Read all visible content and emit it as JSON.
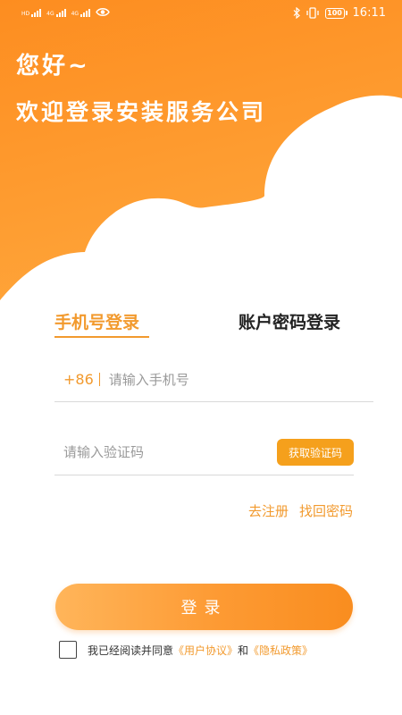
{
  "status_bar": {
    "net_tags": [
      "HD",
      "4G",
      "4G"
    ],
    "battery": "100",
    "time": "16:11",
    "icons": [
      "bluetooth-icon",
      "vibrate-icon",
      "eye-icon",
      "signal-icon"
    ]
  },
  "header": {
    "greeting": "您好~",
    "welcome": "欢迎登录安装服务公司"
  },
  "tabs": {
    "phone_login": "手机号登录",
    "account_login": "账户密码登录",
    "active": "phone_login"
  },
  "phone": {
    "country_code": "+86",
    "placeholder": "请输入手机号"
  },
  "verify": {
    "placeholder": "请输入验证码",
    "button": "获取验证码"
  },
  "links": {
    "register": "去注册",
    "forgot": "找回密码"
  },
  "login_button": "登录",
  "agreement": {
    "prefix": "我已经阅读并同意",
    "user_agreement": "《用户协议》",
    "and": "和",
    "privacy": "《隐私政策》",
    "checked": false
  },
  "colors": {
    "accent": "#f29a2e",
    "hero_top": "#fd8f22",
    "hero_bottom": "#ffa53a"
  }
}
